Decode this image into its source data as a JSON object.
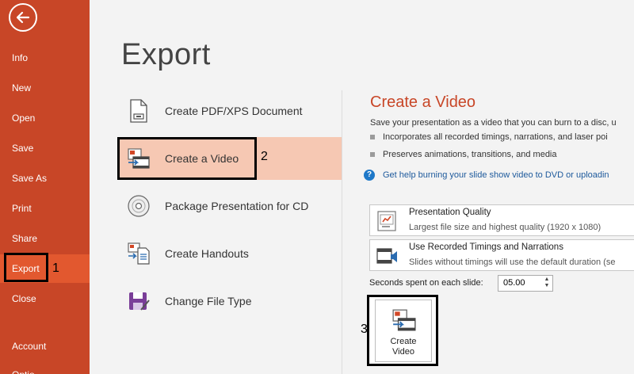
{
  "sidebar": {
    "items": [
      {
        "label": "Info"
      },
      {
        "label": "New"
      },
      {
        "label": "Open"
      },
      {
        "label": "Save"
      },
      {
        "label": "Save As"
      },
      {
        "label": "Print"
      },
      {
        "label": "Share"
      },
      {
        "label": "Export"
      },
      {
        "label": "Close"
      },
      {
        "label": "Account"
      },
      {
        "label": "Optio"
      }
    ],
    "active": "Export"
  },
  "main": {
    "title": "Export",
    "options": [
      {
        "label": "Create PDF/XPS Document",
        "icon": "pdf-document-icon"
      },
      {
        "label": "Create a Video",
        "icon": "video-icon"
      },
      {
        "label": "Package Presentation for CD",
        "icon": "cd-icon"
      },
      {
        "label": "Create Handouts",
        "icon": "handouts-icon"
      },
      {
        "label": "Change File Type",
        "icon": "file-type-icon"
      }
    ],
    "selected": "Create a Video"
  },
  "panel": {
    "title": "Create a Video",
    "description": "Save your presentation as a video that you can burn to a disc, u",
    "bullets": [
      "Incorporates all recorded timings, narrations, and laser poi",
      "Preserves animations, transitions, and media"
    ],
    "help_link": "Get help burning your slide show video to DVD or uploadin",
    "quality": {
      "title": "Presentation Quality",
      "subtitle": "Largest file size and highest quality (1920 x 1080)"
    },
    "timings": {
      "title": "Use Recorded Timings and Narrations",
      "subtitle": "Slides without timings will use the default duration (se"
    },
    "seconds_label": "Seconds spent on each slide:",
    "seconds_value": "05.00",
    "create_button": {
      "line1": "Create",
      "line2": "Video"
    }
  },
  "annotations": {
    "step1": "1",
    "step2": "2",
    "step3": "3"
  },
  "colors": {
    "sidebar": "#c84627",
    "active": "#e2582f",
    "accent": "#c84627",
    "selected": "#f6c8b3",
    "link": "#1e5a9c"
  }
}
